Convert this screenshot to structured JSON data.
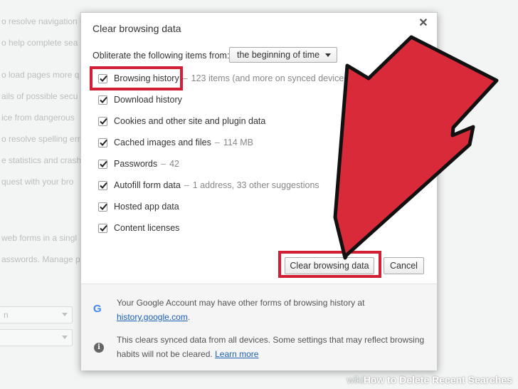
{
  "background": {
    "lines": [
      "o resolve navigation e",
      "o help complete sea",
      "o load pages more q",
      "ails of possible secu",
      "ice from dangerous",
      "o resolve spelling err",
      "e statistics and crash",
      "quest with your bro",
      "web forms in a singl",
      "asswords. Manage p"
    ],
    "select_text": "n"
  },
  "dialog": {
    "title": "Clear browsing data",
    "close_glyph": "✕",
    "from_label": "Obliterate the following items from:",
    "from_value": "the beginning of time",
    "options": [
      {
        "label": "Browsing history",
        "meta": "123 items (and more on synced devices)",
        "checked": true
      },
      {
        "label": "Download history",
        "meta": "",
        "checked": true
      },
      {
        "label": "Cookies and other site and plugin data",
        "meta": "",
        "checked": true
      },
      {
        "label": "Cached images and files",
        "meta": "114 MB",
        "checked": true
      },
      {
        "label": "Passwords",
        "meta": "42",
        "checked": true
      },
      {
        "label": "Autofill form data",
        "meta": "1 address, 33 other suggestions",
        "checked": true
      },
      {
        "label": "Hosted app data",
        "meta": "",
        "checked": true
      },
      {
        "label": "Content licenses",
        "meta": "",
        "checked": true
      }
    ],
    "separator": "–",
    "clear_button": "Clear browsing data",
    "cancel_button": "Cancel",
    "footer": {
      "google_glyph": "G",
      "account_text": "Your Google Account may have other forms of browsing history at",
      "account_link": "history.google.com",
      "account_suffix": ".",
      "info_glyph": "i",
      "sync_text_1": "This clears synced data from all devices. Some settings that may reflect browsing",
      "sync_text_2": "habits will not be cleared.",
      "learn_more": "Learn more"
    }
  },
  "watermark": {
    "wiki": "wiki",
    "text": "How to Delete Recent Searches"
  },
  "colors": {
    "highlight": "#d21f33",
    "arrow_fill": "#d92a3a",
    "link": "#1a5fb4"
  }
}
